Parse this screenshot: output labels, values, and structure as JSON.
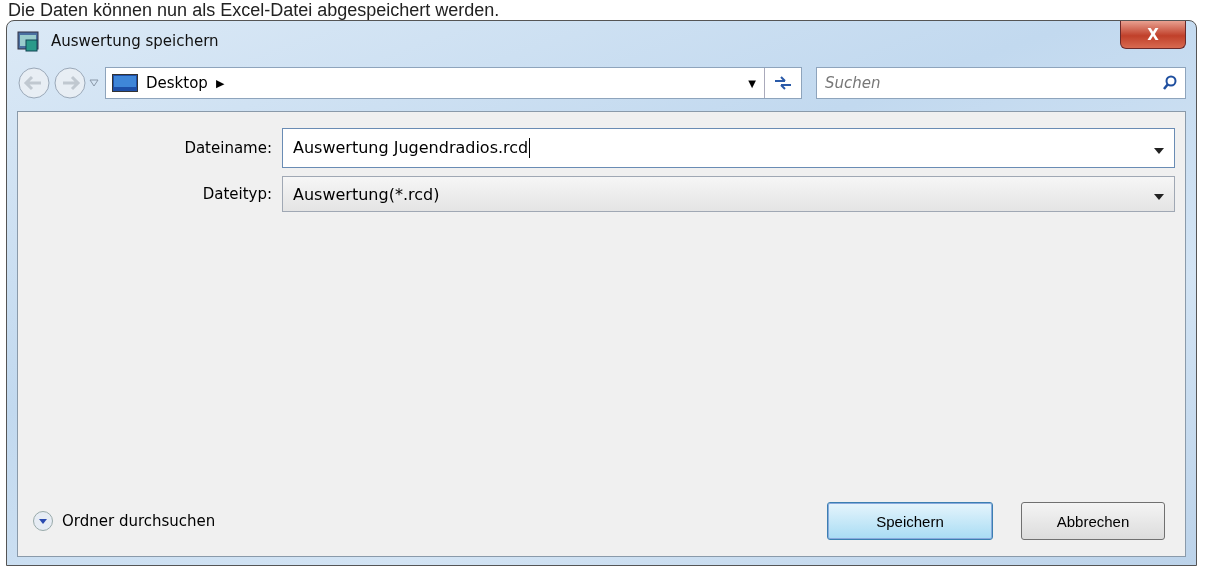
{
  "caption": "Die Daten können nun als Excel-Datei abgespeichert werden.",
  "window": {
    "title": "Auswertung speichern",
    "close": "X"
  },
  "address_bar": {
    "location": "Desktop",
    "arrow": "▶",
    "dropdown": "▼"
  },
  "search": {
    "placeholder": "Suchen"
  },
  "fields": [
    {
      "label": "Dateiname:",
      "value": "Auswertung Jugendradios.rcd",
      "kind": "input"
    },
    {
      "label": "Dateityp:",
      "value": "Auswertung(*.rcd)",
      "kind": "select"
    }
  ],
  "browse_toggle": {
    "label": "Ordner durchsuchen",
    "expanded": false
  },
  "buttons": [
    {
      "label": "Speichern",
      "default": true
    },
    {
      "label": "Abbrechen",
      "default": false
    }
  ]
}
